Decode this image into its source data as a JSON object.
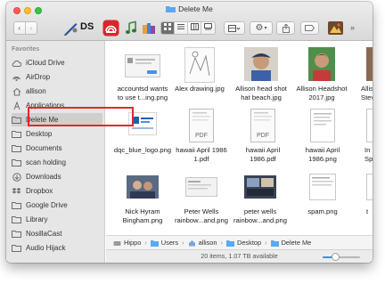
{
  "window": {
    "title": "Delete Me"
  },
  "toolbar": {
    "ds_label": "DS",
    "back_icon": "chevron-left-icon",
    "forward_icon": "chevron-right-icon",
    "view_modes": [
      "icon-view",
      "list-view",
      "column-view",
      "gallery-view"
    ],
    "active_view": "icon-view"
  },
  "sidebar": {
    "header": "Favorites",
    "items": [
      {
        "label": "iCloud Drive",
        "icon": "cloud-icon"
      },
      {
        "label": "AirDrop",
        "icon": "airdrop-icon"
      },
      {
        "label": "allison",
        "icon": "home-icon"
      },
      {
        "label": "Applications",
        "icon": "applications-icon"
      },
      {
        "label": "Delete Me",
        "icon": "folder-icon"
      },
      {
        "label": "Desktop",
        "icon": "folder-icon"
      },
      {
        "label": "Documents",
        "icon": "folder-icon"
      },
      {
        "label": "scan holding",
        "icon": "folder-icon"
      },
      {
        "label": "Downloads",
        "icon": "downloads-icon"
      },
      {
        "label": "Dropbox",
        "icon": "dropbox-icon"
      },
      {
        "label": "Google Drive",
        "icon": "folder-icon"
      },
      {
        "label": "Library",
        "icon": "folder-icon"
      },
      {
        "label": "NosillaCast",
        "icon": "folder-icon"
      },
      {
        "label": "Audio Hijack",
        "icon": "folder-icon"
      }
    ],
    "selected": "Delete Me"
  },
  "files": [
    {
      "line1": "accountsd wants",
      "line2": "to use t...ing.png",
      "kind": "dialog-thumbnail"
    },
    {
      "line1": "Alex drawing.jpg",
      "line2": "",
      "kind": "drawing-thumbnail"
    },
    {
      "line1": "Allison head shot",
      "line2": "hat beach.jpg",
      "kind": "photo-thumbnail"
    },
    {
      "line1": "Allison Headshot",
      "line2": "2017.jpg",
      "kind": "photo-thumbnail"
    },
    {
      "line1": "Allis",
      "line2": "Stev",
      "kind": "photo-thumbnail"
    },
    {
      "line1": "dqc_blue_logo.png",
      "line2": "",
      "kind": "logo-thumbnail"
    },
    {
      "line1": "hawaii April 1986",
      "line2": "1.pdf",
      "kind": "pdf-thumbnail",
      "badge": "PDF"
    },
    {
      "line1": "hawaii April",
      "line2": "1986.pdf",
      "kind": "pdf-thumbnail",
      "badge": "PDF"
    },
    {
      "line1": "hawaii April",
      "line2": "1986.png",
      "kind": "document-thumbnail"
    },
    {
      "line1": "In",
      "line2": "Spac",
      "kind": "document-thumbnail"
    },
    {
      "line1": "Nick Hyram",
      "line2": "Bingham.png",
      "kind": "screenshot-thumbnail"
    },
    {
      "line1": "Peter Wells",
      "line2": "rainbow...and.png",
      "kind": "screenshot-thumbnail"
    },
    {
      "line1": "peter wells",
      "line2": "rainbow...and.png",
      "kind": "screenshot-thumbnail"
    },
    {
      "line1": "spam.png",
      "line2": "",
      "kind": "document-thumbnail"
    },
    {
      "line1": "t",
      "line2": "",
      "kind": "document-thumbnail"
    }
  ],
  "pathbar": {
    "crumbs": [
      "Hippo",
      "Users",
      "allison",
      "Desktop",
      "Delete Me"
    ]
  },
  "status": {
    "text": "20 items, 1.07 TB available",
    "zoom_fraction": 0.35
  },
  "colors": {
    "highlight": "#e8262a",
    "folder_blue": "#5aaaf0",
    "selection_gray": "#cfcfcf"
  }
}
